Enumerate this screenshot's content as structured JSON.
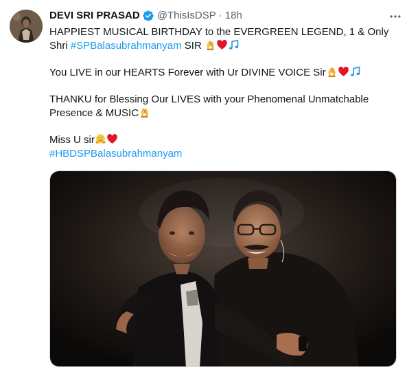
{
  "tweet": {
    "display_name": "DEVI SRI PRASAD",
    "handle": "@ThisIsDSP",
    "separator": "·",
    "time": "18h",
    "lines": [
      {
        "parts": [
          {
            "type": "text",
            "value": "HAPPIEST MUSICAL BIRTHDAY to the EVERGREEN LEGEND, 1 & Only Shri "
          },
          {
            "type": "hashtag",
            "value": "#SPBalasubrahmanyam"
          },
          {
            "type": "text",
            "value": " SIR "
          },
          {
            "type": "emoji",
            "value": "folded-hands"
          },
          {
            "type": "emoji",
            "value": "red-heart"
          },
          {
            "type": "emoji",
            "value": "musical-notes"
          }
        ]
      },
      {
        "parts": [
          {
            "type": "text",
            "value": "You LIVE in our HEARTS Forever with Ur DIVINE VOICE Sir"
          },
          {
            "type": "emoji",
            "value": "folded-hands"
          },
          {
            "type": "emoji",
            "value": "red-heart"
          },
          {
            "type": "emoji",
            "value": "musical-notes"
          }
        ]
      },
      {
        "parts": [
          {
            "type": "text",
            "value": "THANKU for Blessing Our LIVES with your Phenomenal Unmatchable Presence & MUSIC"
          },
          {
            "type": "emoji",
            "value": "folded-hands"
          }
        ]
      },
      {
        "parts": [
          {
            "type": "text",
            "value": "Miss U sir"
          },
          {
            "type": "emoji",
            "value": "hugging-face"
          },
          {
            "type": "emoji",
            "value": "red-heart"
          }
        ],
        "tight_next": true
      },
      {
        "parts": [
          {
            "type": "hashtag",
            "value": "#HBDSPBalasubrahmanyam"
          }
        ]
      }
    ]
  },
  "colors": {
    "text": "#0f1419",
    "secondary": "#536471",
    "link": "#1d9bf0",
    "verified": "#1d9bf0",
    "border": "#cfd9de"
  },
  "icons": {
    "verified": "verified-badge-icon",
    "more": "more-horizontal-icon"
  }
}
